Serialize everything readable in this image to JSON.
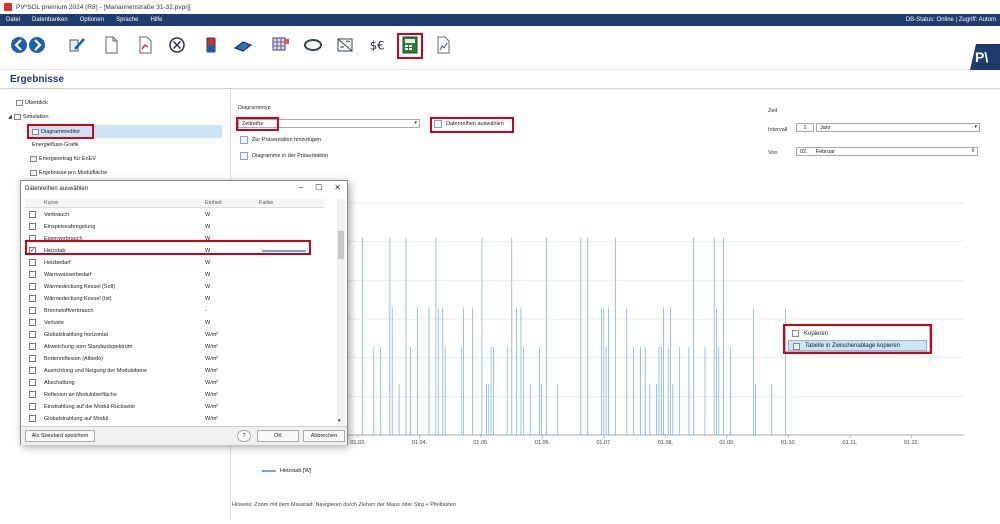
{
  "window": {
    "title": "PV*SOL premium 2024 (R8) - [Mariannenstraße 31-32.pvprj]"
  },
  "menu": {
    "items": [
      "Datei",
      "Datenbanken",
      "Optionen",
      "Sprache",
      "Hilfe"
    ],
    "status": "DB-Status: Online | Zugriff: Autom"
  },
  "brand": {
    "text": "P\\"
  },
  "section": {
    "title": "Ergebnisse"
  },
  "tree": {
    "items": [
      {
        "label": "Überblick"
      },
      {
        "label": "Simulation"
      },
      {
        "label": "Diagrammeditor"
      },
      {
        "label": "Energiefluss-Grafik"
      },
      {
        "label": "Energieertrag für EnEV"
      },
      {
        "label": "Ergebnisse pro Modulfläche"
      }
    ]
  },
  "editor": {
    "diagram_type_label": "Diagrammtyp",
    "diagram_type_value": "Zeitreihe",
    "select_series_button": "Datenreihen auswählen",
    "add_presentation_button": "Zur Präsentation hinzufügen",
    "diagrams_in_presentation_button": "Diagramme in der Präsentation"
  },
  "time": {
    "heading": "Zeit",
    "interval_label": "Intervall",
    "interval_count": "1",
    "interval_unit": "Jahr",
    "from_label": "Von",
    "from_day": "02.",
    "from_month": "Februar"
  },
  "chart_data": {
    "type": "bar",
    "x_tick_labels": [
      "01.03.",
      "01.04.",
      "01.05.",
      "01.06.",
      "01.07.",
      "01.08.",
      "01.09.",
      "01.10.",
      "01.11.",
      "01.12."
    ],
    "legend": "Heizstab [W]",
    "series_color": "#6fa8dc"
  },
  "hint": {
    "text": "Hinweis: Zoom mit dem Mausrad. Navigieren durch Ziehen der Maus oder Strg + Pfeiltasten"
  },
  "context_menu": {
    "items": [
      "Kopieren",
      "Tabelle in Zwischenablage kopieren"
    ]
  },
  "dialog": {
    "title": "Datenreihen auswählen",
    "col_curve": "Kurve",
    "col_unit": "Einheit",
    "col_color": "Farbe",
    "rows": [
      {
        "name": "Verbrauch",
        "unit": "W",
        "checked": false
      },
      {
        "name": "Einspeiseabregelung",
        "unit": "W",
        "checked": false
      },
      {
        "name": "Eigenverbrauch",
        "unit": "W",
        "checked": false
      },
      {
        "name": "Heizstab",
        "unit": "W",
        "checked": true
      },
      {
        "name": "Heizbedarf",
        "unit": "W",
        "checked": false
      },
      {
        "name": "Warmwasserbedarf",
        "unit": "W",
        "checked": false
      },
      {
        "name": "Wärmedeckung Kessel (Soll)",
        "unit": "W",
        "checked": false
      },
      {
        "name": "Wärmedeckung Kessel (Ist)",
        "unit": "W",
        "checked": false
      },
      {
        "name": "Brennstoffverbrauch",
        "unit": "-",
        "checked": false
      },
      {
        "name": "Verluste",
        "unit": "W",
        "checked": false
      },
      {
        "name": "Globalstrahlung horizontal",
        "unit": "W/m²",
        "checked": false
      },
      {
        "name": "Abweichung vom Standardspektrum",
        "unit": "W/m²",
        "checked": false
      },
      {
        "name": "Bodenreflexion (Albedo)",
        "unit": "W/m²",
        "checked": false
      },
      {
        "name": "Ausrichtung und Neigung der Modulebene",
        "unit": "W/m²",
        "checked": false
      },
      {
        "name": "Abschattung",
        "unit": "W/m²",
        "checked": false
      },
      {
        "name": "Reflexion an Moduloberfläche",
        "unit": "W/m²",
        "checked": false
      },
      {
        "name": "Einstrahlung auf die Modul-Rückseite",
        "unit": "W/m²",
        "checked": false
      },
      {
        "name": "Globalstrahlung auf Modul",
        "unit": "W/m²",
        "checked": false
      }
    ],
    "save_default_button": "Als Standard speichern",
    "help_button": "?",
    "ok_button": "OK",
    "cancel_button": "Abbrechen",
    "minimize": "–",
    "maximize": "☐",
    "close": "✕"
  }
}
